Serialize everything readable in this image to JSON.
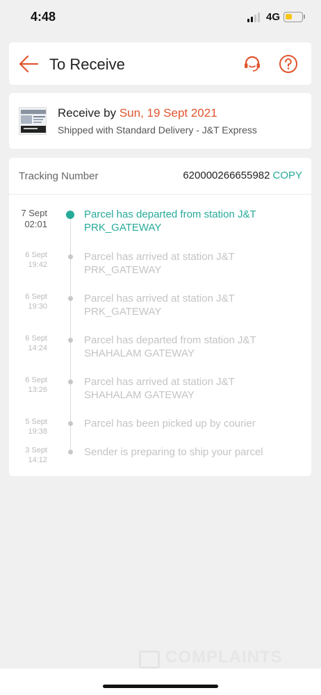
{
  "status_bar": {
    "time": "4:48",
    "network": "4G"
  },
  "header": {
    "title": "To Receive",
    "back_icon": "back-arrow-icon",
    "support_icon": "headset-icon",
    "help_icon": "question-mark-icon",
    "accent_color": "#e0552e"
  },
  "delivery": {
    "receive_prefix": "Receive by ",
    "receive_date": "Sun, 19 Sept 2021",
    "shipping": "Shipped with Standard Delivery  - J&T Express"
  },
  "tracking": {
    "label": "Tracking Number",
    "number": "620000266655982",
    "copy_label": "COPY",
    "accent_color": "#26aa99",
    "events": [
      {
        "date": "7 Sept",
        "time": "02:01",
        "text": "Parcel has departed from station J&T PRK_GATEWAY",
        "current": true
      },
      {
        "date": "6 Sept",
        "time": "19:42",
        "text": "Parcel has arrived at station J&T PRK_GATEWAY",
        "current": false
      },
      {
        "date": "6 Sept",
        "time": "19:30",
        "text": "Parcel has arrived at station J&T PRK_GATEWAY",
        "current": false
      },
      {
        "date": "6 Sept",
        "time": "14:24",
        "text": "Parcel has departed from station J&T SHAHALAM GATEWAY",
        "current": false
      },
      {
        "date": "6 Sept",
        "time": "13:26",
        "text": "Parcel has arrived at station J&T SHAHALAM GATEWAY",
        "current": false
      },
      {
        "date": "5 Sept",
        "time": "19:38",
        "text": "Parcel has been picked up by courier",
        "current": false
      },
      {
        "date": "3 Sept",
        "time": "14:12",
        "text": "Sender is preparing to ship your parcel",
        "current": false
      }
    ]
  },
  "watermark": {
    "text": "COMPLAINTS"
  }
}
